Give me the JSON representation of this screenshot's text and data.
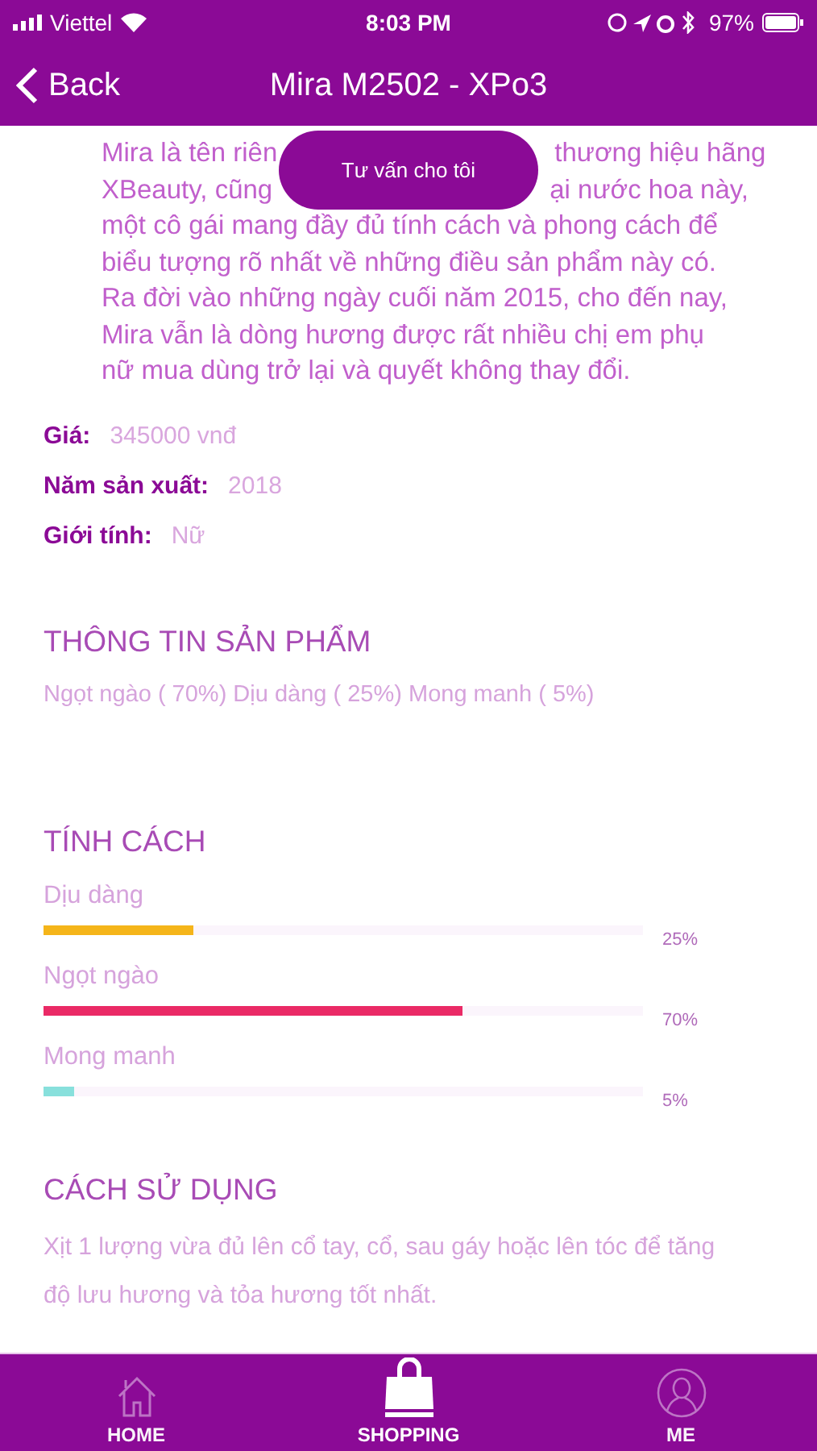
{
  "status_bar": {
    "carrier": "Viettel",
    "time": "8:03 PM",
    "battery": "97%"
  },
  "nav": {
    "back": "Back",
    "title": "Mira M2502 - XPo3"
  },
  "description_lines": [
    [
      "Mira là tên riên",
      "thương hiệu hãng"
    ],
    [
      "XBeauty, cũng",
      "ại nước hoa này,"
    ],
    [
      "một cô gái mang đầy đủ tính cách và phong cách để"
    ],
    [
      "biểu tượng rõ nhất về những điều sản phẩm này có."
    ],
    [
      "Ra đời vào những ngày cuối năm 2015, cho đến nay,"
    ],
    [
      "Mira vẫn là dòng hương được rất nhiều chị em phụ"
    ],
    [
      "nữ mua dùng trở lại và quyết không thay đổi."
    ]
  ],
  "consult_button": "Tư vấn cho tôi",
  "fields": [
    {
      "label": "Giá:",
      "value": "345000 vnđ"
    },
    {
      "label": "Năm sản xuất:",
      "value": "2018"
    },
    {
      "label": "Giới tính:",
      "value": "Nữ"
    }
  ],
  "product_info": {
    "heading": "THÔNG TIN SẢN PHẨM",
    "text": "Ngọt ngào ( 70%) Dịu dàng ( 25%) Mong manh ( 5%)"
  },
  "personality": {
    "heading": "TÍNH CÁCH",
    "traits": [
      {
        "name": "Dịu dàng",
        "level": 0.25,
        "reading": "25%",
        "color": "#f5b51a"
      },
      {
        "name": "Ngọt ngào",
        "level": 0.7,
        "reading": "70%",
        "color": "#ea2a66"
      },
      {
        "name": "Mong manh",
        "level": 0.05,
        "reading": "5%",
        "color": "#88e0dc"
      }
    ]
  },
  "usage": {
    "heading": "CÁCH SỬ DỤNG",
    "text": "Xịt 1 lượng vừa đủ lên cổ tay, cổ, sau gáy hoặc lên tóc để tăng độ lưu hương và tỏa hương tốt nhất."
  },
  "tabs": [
    {
      "label": "HOME",
      "kind": "home",
      "selected": false
    },
    {
      "label": "SHOPPING",
      "kind": "shopping",
      "selected": true
    },
    {
      "label": "ME",
      "kind": "profile",
      "selected": false
    }
  ]
}
